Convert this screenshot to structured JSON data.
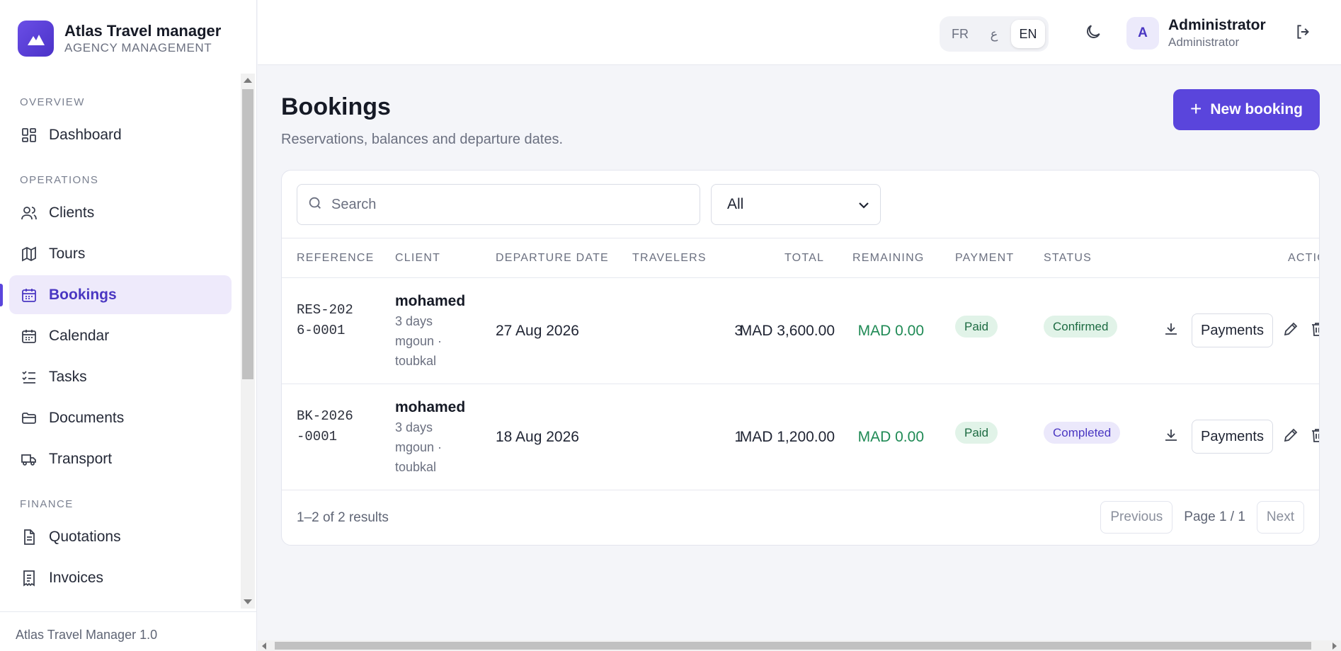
{
  "app": {
    "title": "Atlas Travel manager",
    "subtitle": "AGENCY MANAGEMENT",
    "version": "Atlas Travel Manager 1.0"
  },
  "sidebar": {
    "sections": [
      {
        "label": "OVERVIEW",
        "items": [
          {
            "label": "Dashboard",
            "icon": "dashboard-icon"
          }
        ]
      },
      {
        "label": "OPERATIONS",
        "items": [
          {
            "label": "Clients",
            "icon": "users-icon"
          },
          {
            "label": "Tours",
            "icon": "map-icon"
          },
          {
            "label": "Bookings",
            "icon": "calendar-check-icon",
            "active": true
          },
          {
            "label": "Calendar",
            "icon": "calendar-icon"
          },
          {
            "label": "Tasks",
            "icon": "tasks-icon"
          },
          {
            "label": "Documents",
            "icon": "folder-icon"
          },
          {
            "label": "Transport",
            "icon": "truck-icon"
          }
        ]
      },
      {
        "label": "FINANCE",
        "items": [
          {
            "label": "Quotations",
            "icon": "document-icon"
          },
          {
            "label": "Invoices",
            "icon": "receipt-icon"
          }
        ]
      }
    ]
  },
  "topbar": {
    "languages": [
      {
        "label": "FR"
      },
      {
        "label": "ع"
      },
      {
        "label": "EN",
        "active": true
      }
    ],
    "user": {
      "initial": "A",
      "name": "Administrator",
      "role": "Administrator"
    }
  },
  "page": {
    "title": "Bookings",
    "subtitle": "Reservations, balances and departure dates.",
    "new_button": "New booking"
  },
  "filters": {
    "search_placeholder": "Search",
    "status_filter": "All"
  },
  "table": {
    "columns": [
      "REFERENCE",
      "CLIENT",
      "DEPARTURE DATE",
      "TRAVELERS",
      "TOTAL",
      "REMAINING",
      "PAYMENT",
      "STATUS",
      "ACTIONS"
    ],
    "rows": [
      {
        "reference": "RES-2026-0001",
        "client": "mohamed",
        "tour": "3 days mgoun · toubkal",
        "departure": "27 Aug 2026",
        "travelers": "3",
        "total": "MAD 3,600.00",
        "remaining": "MAD 0.00",
        "payment": "Paid",
        "status": "Confirmed",
        "payments_label": "Payments"
      },
      {
        "reference": "BK-2026-0001",
        "client": "mohamed",
        "tour": "3 days mgoun · toubkal",
        "departure": "18 Aug 2026",
        "travelers": "1",
        "total": "MAD 1,200.00",
        "remaining": "MAD 0.00",
        "payment": "Paid",
        "status": "Completed",
        "payments_label": "Payments"
      }
    ]
  },
  "pagination": {
    "summary": "1–2 of 2 results",
    "previous": "Previous",
    "page": "Page 1 / 1",
    "next": "Next"
  },
  "colors": {
    "accent": "#5a45dc",
    "success": "#1f8a55"
  }
}
